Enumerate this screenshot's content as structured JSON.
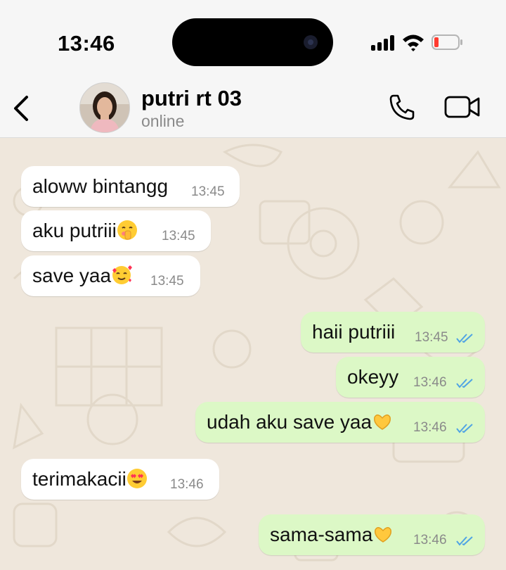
{
  "status_bar": {
    "time": "13:46"
  },
  "header": {
    "name": "putri rt 03",
    "status": "online"
  },
  "messages": [
    {
      "text": "aloww bintangg",
      "time": "13:45",
      "dir": "in"
    },
    {
      "text": "aku putriii",
      "emoji": "shushing-face-emoji",
      "time": "13:45",
      "dir": "in"
    },
    {
      "text": "save yaa",
      "emoji": "smiling-face-with-hearts-emoji",
      "time": "13:45",
      "dir": "in"
    },
    {
      "text": "haii putriii",
      "time": "13:45",
      "dir": "out",
      "ticks": "read"
    },
    {
      "text": "okeyy",
      "time": "13:46",
      "dir": "out",
      "ticks": "read"
    },
    {
      "text": "udah aku save yaa",
      "emoji": "heart-hands-emoji",
      "time": "13:46",
      "dir": "out",
      "ticks": "read"
    },
    {
      "text": "terimakacii",
      "emoji": "heart-eyes-emoji",
      "time": "13:46",
      "dir": "in"
    },
    {
      "text": "sama-sama",
      "emoji": "heart-hands-emoji",
      "time": "13:46",
      "dir": "out",
      "ticks": "read"
    }
  ],
  "colors": {
    "incoming": "#ffffff",
    "outgoing": "#dcf8c6",
    "read_ticks": "#4fa3e4",
    "wallpaper": "#efe7dc",
    "battery_low": "#ff3b30"
  }
}
